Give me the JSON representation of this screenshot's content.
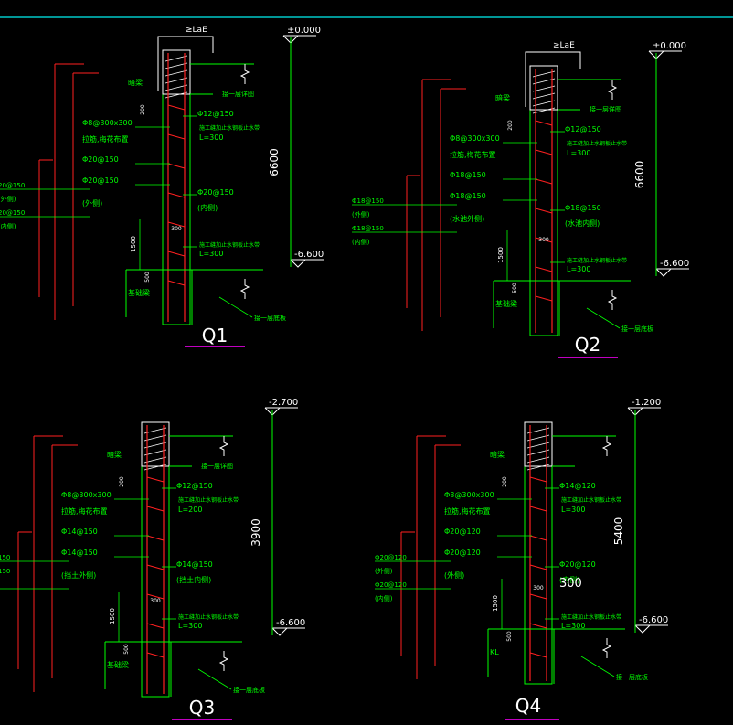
{
  "colors": {
    "background": "#000000",
    "concrete": "#00ff00",
    "rebar": "#ff2020",
    "annotation": "#00ff00",
    "dimension": "#ffffff",
    "elevation": "#ffffff",
    "title_underline": "#ff00ff",
    "top_rule": "#00c8c8",
    "break_line": "#ffffff",
    "hatch": "#ffffff"
  },
  "panels": [
    {
      "id": "Q1",
      "title": "Q1",
      "top_elevation": "±0.000",
      "bottom_elevation": "-6.600",
      "height_dim": "6600",
      "anchor": "≥LaE",
      "top_note": "接一层详图",
      "bottom_note": "接一层底板",
      "top_label": "暗梁",
      "bottom_label": "基础梁",
      "dim_200": "200",
      "dim_300": "300",
      "dim_1500": "1500",
      "dim_500": "500",
      "left_labels": [
        "Φ8@300x300",
        "拉筋,梅花布置",
        "Φ20@150",
        "Φ20@150",
        "(外侧)"
      ],
      "right_labels": [
        "Φ12@150",
        "施工缝加止水钢板止水带",
        "L=300",
        "Φ20@150",
        "(内侧)",
        "施工缝加止水钢板止水带",
        "L=300"
      ],
      "left_edge_labels": [
        "20@150",
        "(外侧)",
        "20@150",
        "(内侧)"
      ],
      "extra_label": ""
    },
    {
      "id": "Q2",
      "title": "Q2",
      "top_elevation": "±0.000",
      "bottom_elevation": "-6.600",
      "height_dim": "6600",
      "anchor": "≥LaE",
      "top_note": "接一层详图",
      "bottom_note": "接一层底板",
      "top_label": "暗梁",
      "bottom_label": "基础梁",
      "dim_200": "200",
      "dim_300": "300",
      "dim_1500": "1500",
      "dim_500": "500",
      "left_labels": [
        "Φ8@300x300",
        "拉筋,梅花布置",
        "Φ18@150",
        "Φ18@150",
        "(水池外侧)"
      ],
      "right_labels": [
        "Φ12@150",
        "施工缝加止水钢板止水带",
        "L=300",
        "Φ18@150",
        "(水池内侧)",
        "施工缝加止水钢板止水带",
        "L=300"
      ],
      "left_edge_labels": [
        "Φ18@150",
        "(外侧)",
        "Φ18@150",
        "(内侧)"
      ],
      "extra_label": ""
    },
    {
      "id": "Q3",
      "title": "Q3",
      "top_elevation": "-2.700",
      "bottom_elevation": "-6.600",
      "height_dim": "3900",
      "anchor": "",
      "top_note": "接一层详图",
      "bottom_note": "接一层底板",
      "top_label": "暗梁",
      "bottom_label": "基础梁",
      "dim_200": "200",
      "dim_300": "300",
      "dim_1500": "1500",
      "dim_500": "500",
      "left_labels": [
        "Φ8@300x300",
        "拉筋,梅花布置",
        "Φ14@150",
        "Φ14@150",
        "(挡土外侧)"
      ],
      "right_labels": [
        "Φ12@150",
        "施工缝加止水钢板止水带",
        "L=200",
        "Φ14@150",
        "(挡土内侧)",
        "施工缝加止水钢板止水带",
        "L=300"
      ],
      "left_edge_labels": [
        "150",
        "150"
      ],
      "extra_label": ""
    },
    {
      "id": "Q4",
      "title": "Q4",
      "top_elevation": "-1.200",
      "bottom_elevation": "-6.600",
      "height_dim": "5400",
      "anchor": "",
      "top_note": "",
      "bottom_note": "接一层底板",
      "top_label": "暗梁",
      "bottom_label": "KL",
      "dim_200": "200",
      "dim_300": "300",
      "dim_1500": "1500",
      "dim_500": "500",
      "left_labels": [
        "Φ8@300x300",
        "拉筋,梅花布置",
        "Φ20@120",
        "Φ20@120",
        "(外侧)"
      ],
      "right_labels": [
        "Φ14@120",
        "施工缝加止水钢板止水带",
        "L=300",
        "Φ20@120",
        "(内侧)",
        "施工缝加止水钢板止水带",
        "L=300"
      ],
      "left_edge_labels": [
        "Φ20@120",
        "(外侧)",
        "Φ20@120",
        "(内侧)"
      ],
      "extra_label": "300"
    }
  ]
}
